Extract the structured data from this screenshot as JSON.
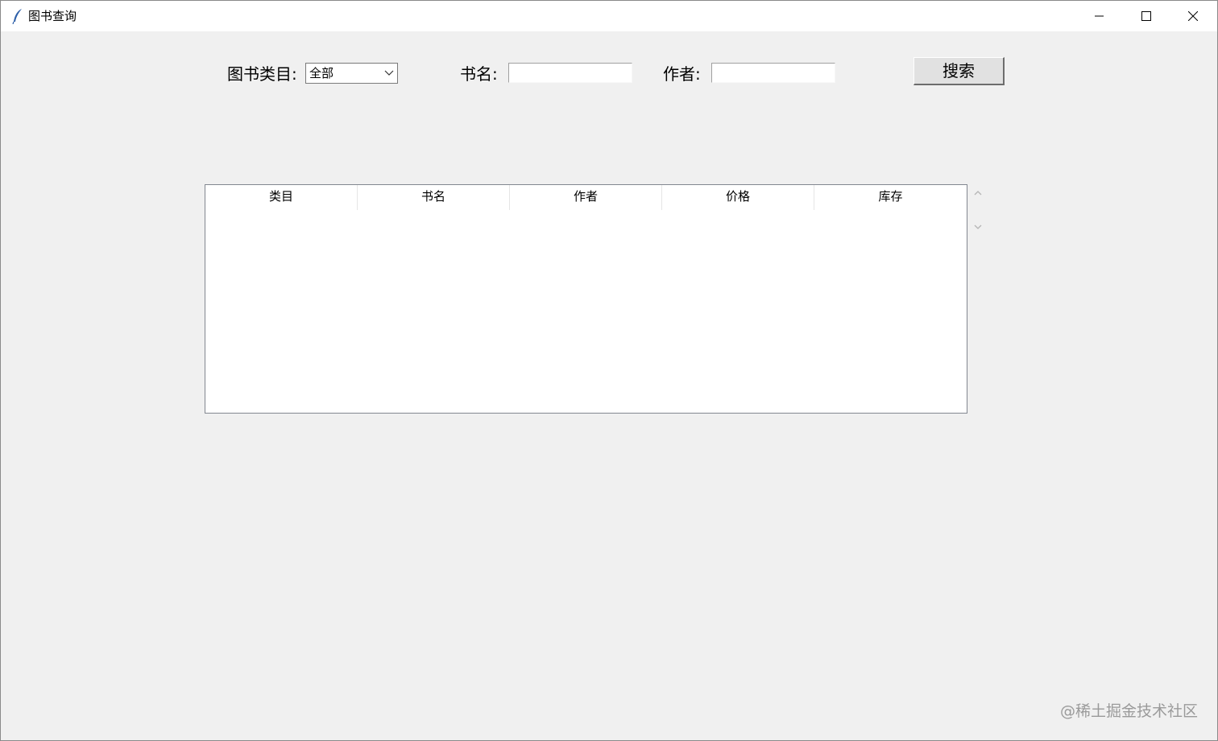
{
  "window": {
    "title": "图书查询",
    "controls": [
      "minimize-icon",
      "maximize-icon",
      "close-icon"
    ]
  },
  "search_form": {
    "category_label": "图书类目:",
    "category_value": "全部",
    "book_name_label": "书名:",
    "book_name_value": "",
    "author_label": "作者:",
    "author_value": "",
    "search_button": "搜索"
  },
  "table": {
    "columns": [
      "类目",
      "书名",
      "作者",
      "价格",
      "库存"
    ],
    "rows": []
  },
  "watermark": "@稀土掘金技术社区"
}
